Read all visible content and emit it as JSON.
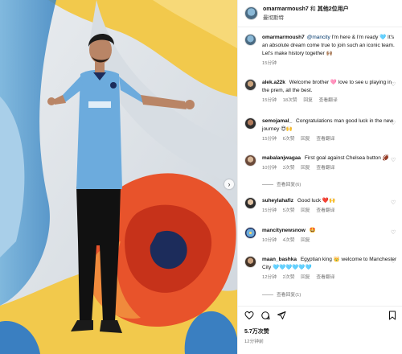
{
  "header": {
    "username": "omarmarmoush7",
    "connector": "和",
    "others": "其他2位用户",
    "subtitle": "曼彻斯特"
  },
  "caption": {
    "username": "omarmarmoush7",
    "mention": "@mancity",
    "text": "I'm here & I'm ready 🩵 It's an absolute dream come true to join such an iconic team. Let's make history together 🙌🏽",
    "time": "15分钟"
  },
  "comments": [
    {
      "username": "alek.a22k",
      "text": "Welcome brother 🩷 love to see u playing in the prem, all the best.",
      "time": "15分钟",
      "likes": "18次赞",
      "reply": "回复",
      "translate": "查看翻译",
      "replies": ""
    },
    {
      "username": "semojamal_",
      "text": "Congratulations man good luck in the new journey 😍🙌",
      "time": "15分钟",
      "likes": "6次赞",
      "reply": "回复",
      "translate": "查看翻译",
      "replies": ""
    },
    {
      "username": "mabalanjwagaa",
      "text": "First goal against Chelsea button 🏈",
      "time": "10分钟",
      "likes": "3次赞",
      "reply": "回复",
      "translate": "查看翻译",
      "replies": "查看回复(6)"
    },
    {
      "username": "suheylahafiz",
      "text": "Good luck ❤️🙌",
      "time": "15分钟",
      "likes": "5次赞",
      "reply": "回复",
      "translate": "查看翻译",
      "replies": ""
    },
    {
      "username": "mancitynewsnow",
      "text": "🤩",
      "time": "10分钟",
      "likes": "4次赞",
      "reply": "回复",
      "translate": "",
      "replies": ""
    },
    {
      "username": "maan_bashka",
      "text": "Egyptian king 👑 welcome to Manchester City 🩵🩵🩵🩵🩵🩵",
      "time": "12分钟",
      "likes": "2次赞",
      "reply": "回复",
      "translate": "查看翻译",
      "replies": "查看回复(1)"
    }
  ],
  "actions": {
    "likes": "5.7万次赞",
    "date": "12分钟前"
  },
  "colors": {
    "mention": "#00376b",
    "muted": "#737373",
    "jersey": "#6cabdd"
  }
}
